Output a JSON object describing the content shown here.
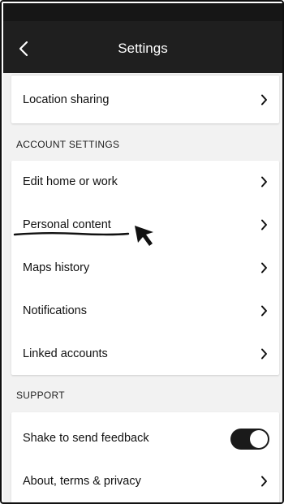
{
  "header": {
    "title": "Settings",
    "back_icon": "chevron-left-icon"
  },
  "location_sharing": {
    "label": "Location sharing"
  },
  "account_settings": {
    "section_title": "ACCOUNT SETTINGS",
    "items": [
      {
        "label": "Edit home or work"
      },
      {
        "label": "Personal content"
      },
      {
        "label": "Maps history"
      },
      {
        "label": "Notifications"
      },
      {
        "label": "Linked accounts"
      }
    ]
  },
  "support": {
    "section_title": "SUPPORT",
    "shake_label": "Shake to send feedback",
    "shake_enabled": true,
    "about_label": "About, terms & privacy"
  },
  "colors": {
    "header_bg": "#1f1f1f",
    "content_bg": "#f2f2f2",
    "toggle_on": "#1a1a1a"
  }
}
